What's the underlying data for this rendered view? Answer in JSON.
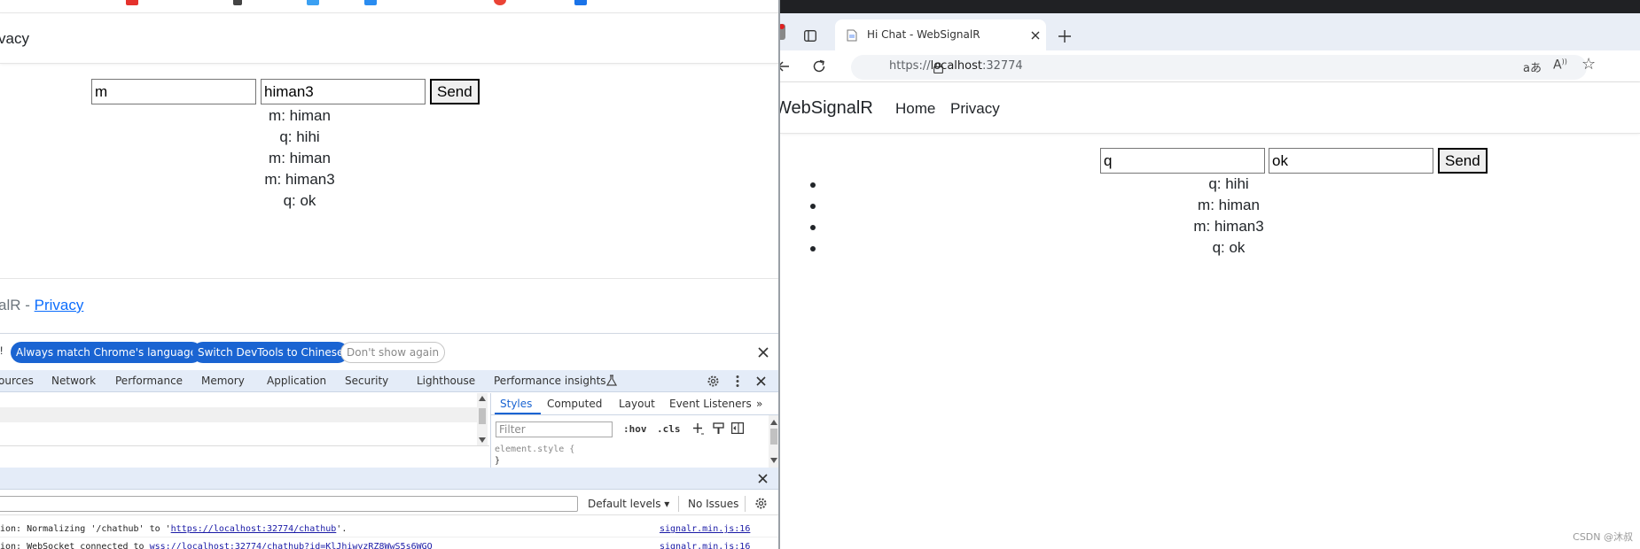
{
  "left_app": {
    "nav_text": "vacy",
    "chat": {
      "user_value": "m",
      "message_value": "himan3",
      "send_label": "Send",
      "messages": [
        "m: himan",
        "q: hihi",
        "m: himan",
        "m: himan3",
        "q: ok"
      ]
    },
    "footer": {
      "prefix": "alR - ",
      "privacy_link": "Privacy"
    }
  },
  "devtools": {
    "banner": {
      "lead": "!",
      "always_match": "Always match Chrome's language",
      "switch_chinese": "Switch DevTools to Chinese",
      "dont_show": "Don't show again"
    },
    "tabs": [
      "ources",
      "Network",
      "Performance",
      "Memory",
      "Application",
      "Security",
      "Lighthouse",
      "Performance insights"
    ],
    "styles_tabs": [
      "Styles",
      "Computed",
      "Layout",
      "Event Listeners"
    ],
    "filter_placeholder": "Filter",
    "hov": ":hov",
    "cls": ".cls",
    "element_style": "element.style {",
    "close_brace": "}",
    "console": {
      "default_levels": "Default levels",
      "no_issues": "No Issues",
      "lines": [
        {
          "prefix": "ion: Normalizing '/chathub' to '",
          "link": "https://localhost:32774/chathub",
          "suffix": "'.",
          "source": "signalr.min.js:16"
        },
        {
          "prefix": "ion: WebSocket connected to ",
          "link": "wss://localhost:32774/chathub?id=KlJhiwyzRZ8WwS5s6WGQ",
          "suffix": "",
          "source": "signalr.min.js:16"
        }
      ]
    }
  },
  "right_browser": {
    "tab_title": "Hi Chat - WebSignalR",
    "url_prefix": "https://",
    "url_host": "localhost",
    "url_port": ":32774",
    "nav": {
      "brand": "WebSignalR",
      "home": "Home",
      "privacy": "Privacy"
    },
    "chat": {
      "user_value": "q",
      "message_value": "ok",
      "send_label": "Send",
      "messages": [
        "q: hihi",
        "m: himan",
        "m: himan3",
        "q: ok"
      ]
    }
  },
  "watermark": "CSDN @沐叔",
  "colors": {
    "accent_blue": "#1a64d2",
    "link_blue": "#0d6efd",
    "devtools_bar": "#e4ecf8"
  }
}
